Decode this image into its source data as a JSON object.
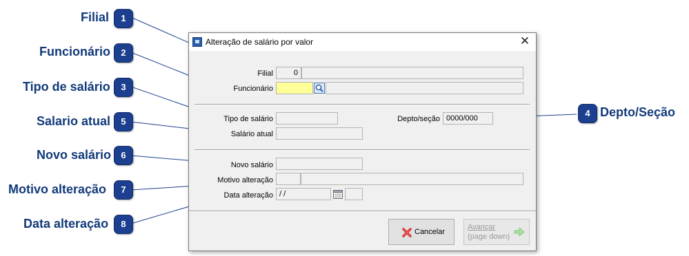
{
  "callouts": [
    {
      "number": "1",
      "label": "Filial"
    },
    {
      "number": "2",
      "label": "Funcionário"
    },
    {
      "number": "3",
      "label": "Tipo de salário"
    },
    {
      "number": "4",
      "label": "Depto/Seção"
    },
    {
      "number": "5",
      "label": "Salario atual"
    },
    {
      "number": "6",
      "label": "Novo salário"
    },
    {
      "number": "7",
      "label": "Motivo alteração"
    },
    {
      "number": "8",
      "label": "Data alteração"
    }
  ],
  "dialog": {
    "title": "Alteração de salário por valor",
    "close_glyph": "✕"
  },
  "form": {
    "filial": {
      "label": "Filial",
      "value": "0",
      "description": ""
    },
    "funcionario": {
      "label": "Funcionário",
      "value": "",
      "description": ""
    },
    "tipo_salario": {
      "label": "Tipo de salário",
      "value": ""
    },
    "depto_secao": {
      "label": "Depto/seção",
      "value": "0000/000"
    },
    "salario_atual": {
      "label": "Salário atual",
      "value": ""
    },
    "novo_salario": {
      "label": "Novo salário",
      "value": ""
    },
    "motivo_alteracao": {
      "label": "Motivo alteração",
      "code": "",
      "description": ""
    },
    "data_alteracao": {
      "label": "Data alteração",
      "value": "/ /",
      "extra": ""
    }
  },
  "buttons": {
    "cancelar": {
      "label": "Cancelar",
      "icon": "red-x-icon"
    },
    "avancar": {
      "label_line1": "Avançar",
      "label_line2": "(page down)",
      "icon": "green-arrow-right-icon",
      "enabled": false
    }
  },
  "colors": {
    "callout_text": "#123a7a",
    "badge": "#1d3f8f",
    "required_field": "#ffff99",
    "leader_line": "#1d3f8f"
  }
}
